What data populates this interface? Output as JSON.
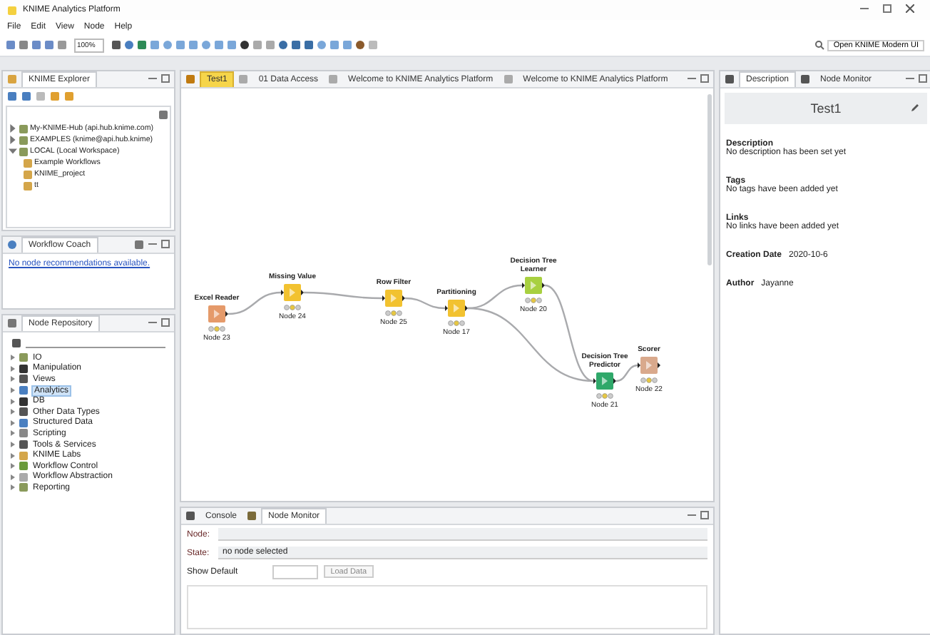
{
  "window": {
    "title": "KNIME Analytics Platform"
  },
  "menu": [
    "File",
    "Edit",
    "View",
    "Node",
    "Help"
  ],
  "toolbar": {
    "zoom": "100%"
  },
  "modern_ui_button": {
    "label": "Open KNIME Modern UI"
  },
  "explorer": {
    "title": "KNIME Explorer",
    "items": [
      {
        "label": "My-KNIME-Hub (api.hub.knime.com)",
        "expanded": false
      },
      {
        "label": "EXAMPLES (knime@api.hub.knime)",
        "expanded": false
      },
      {
        "label": "LOCAL (Local Workspace)",
        "expanded": true,
        "children": [
          {
            "label": "Example Workflows"
          },
          {
            "label": "KNIME_project"
          },
          {
            "label": "tt"
          }
        ]
      }
    ]
  },
  "workflow_coach": {
    "title": "Workflow Coach",
    "link": "No node recommendations available."
  },
  "node_repository": {
    "title": "Node Repository",
    "items": [
      {
        "label": "IO",
        "selected": false
      },
      {
        "label": "Manipulation",
        "selected": false
      },
      {
        "label": "Views",
        "selected": false
      },
      {
        "label": "Analytics",
        "selected": true
      },
      {
        "label": "DB",
        "selected": false
      },
      {
        "label": "Other Data Types",
        "selected": false
      },
      {
        "label": "Structured Data",
        "selected": false
      },
      {
        "label": "Scripting",
        "selected": false
      },
      {
        "label": "Tools & Services",
        "selected": false
      },
      {
        "label": "KNIME Labs",
        "selected": false
      },
      {
        "label": "Workflow Control",
        "selected": false
      },
      {
        "label": "Workflow Abstraction",
        "selected": false
      },
      {
        "label": "Reporting",
        "selected": false
      }
    ]
  },
  "editor": {
    "tabs": [
      {
        "label": "Test1",
        "selected": true
      },
      {
        "label": "01 Data Access",
        "selected": false
      },
      {
        "label": "Welcome to KNIME Analytics Platform",
        "selected": false
      },
      {
        "label": "Welcome to KNIME Analytics Platform",
        "selected": false
      }
    ],
    "nodes": [
      {
        "name": "Excel Reader",
        "status": "Node 23",
        "color": "#e59a6a"
      },
      {
        "name": "Missing Value",
        "status": "Node 24",
        "color": "#f2c230"
      },
      {
        "name": "Row Filter",
        "status": "Node 25",
        "color": "#f2c230"
      },
      {
        "name": "Partitioning",
        "status": "Node 17",
        "color": "#f2c230"
      },
      {
        "name": "Decision Tree Learner",
        "status": "Node 20",
        "color": "#a8d040"
      },
      {
        "name": "Decision Tree Predictor",
        "status": "Node 21",
        "color": "#2fa86a"
      },
      {
        "name": "Scorer",
        "status": "Node 22",
        "color": "#d9a98c"
      }
    ]
  },
  "console": {
    "tabs": [
      {
        "label": "Console",
        "selected": false
      },
      {
        "label": "Node Monitor",
        "selected": true
      }
    ],
    "node_label": "Node:",
    "state_label": "State:",
    "state_value": "no node selected",
    "select_label": "Show Default",
    "button": "Load Data"
  },
  "description": {
    "tabs": [
      {
        "label": "Description",
        "selected": true
      },
      {
        "label": "Node Monitor",
        "selected": false
      }
    ],
    "title": "Test1",
    "fields": [
      {
        "kind": "block",
        "label": "Description",
        "value": "No description has been set yet"
      },
      {
        "kind": "block",
        "label": "Tags",
        "value": "No tags have been added yet"
      },
      {
        "kind": "block",
        "label": "Links",
        "value": "No links have been added yet"
      },
      {
        "kind": "inline",
        "label": "Creation Date",
        "value": "2020-10-6"
      },
      {
        "kind": "inline",
        "label": "Author",
        "value": "Jayanne"
      }
    ]
  }
}
